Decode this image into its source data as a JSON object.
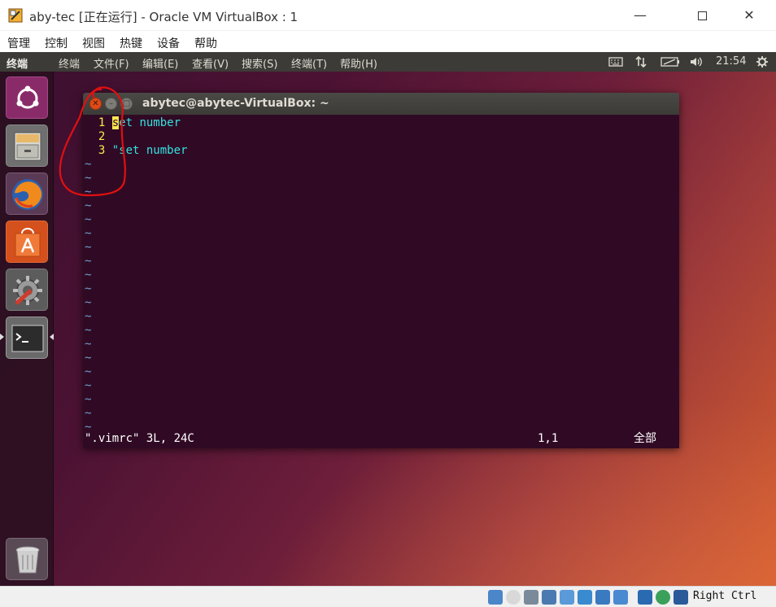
{
  "host_window": {
    "title": "aby-tec [正在运行] - Oracle VM VirtualBox : 1",
    "minimize_glyph": "—",
    "close_glyph": "✕"
  },
  "vbox_menu": [
    "管理",
    "控制",
    "视图",
    "热键",
    "设备",
    "帮助"
  ],
  "ubuntu_topbar": {
    "app_name": "终端",
    "menu": [
      "终端",
      "文件(F)",
      "编辑(E)",
      "查看(V)",
      "搜索(S)",
      "终端(T)",
      "帮助(H)"
    ],
    "clock": "21:54"
  },
  "terminal": {
    "title": "abytec@abytec-VirtualBox: ~",
    "lines": [
      {
        "num": "  1 ",
        "first_char": "s",
        "rest": "et number"
      },
      {
        "num": "  2 ",
        "text": ""
      },
      {
        "num": "  3 ",
        "text": "\"set number"
      }
    ],
    "tilde_glyph": "~",
    "tilde_count": 20,
    "status": {
      "file": "\".vimrc\" 3L, 24C",
      "position": "1,1",
      "scroll": "全部"
    }
  },
  "vbox_status": {
    "host_key": "Right Ctrl"
  },
  "colors": {
    "terminal_bg": "#300a24",
    "line_number": "#fce94f",
    "keyword": "#34e2e2",
    "tilde": "#729fcf",
    "annotation": "#e01010",
    "ubuntu_panel": "#3c3b37"
  }
}
